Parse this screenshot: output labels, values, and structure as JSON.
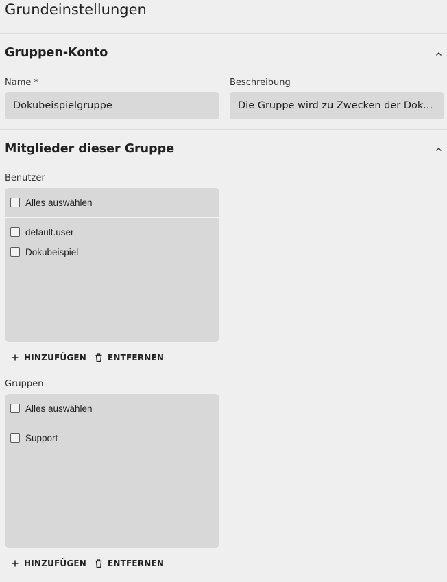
{
  "page": {
    "title": "Grundeinstellungen"
  },
  "group_account": {
    "title": "Gruppen-Konto",
    "name_label": "Name *",
    "name_value": "Dokubeispielgruppe",
    "description_label": "Beschreibung",
    "description_value": "Die Gruppe wird zu Zwecken der Dokumentation angelegt"
  },
  "members": {
    "title": "Mitglieder dieser Gruppe",
    "users": {
      "label": "Benutzer",
      "select_all": "Alles auswählen",
      "items": [
        "default.user",
        "Dokubeispiel"
      ],
      "add_label": "HINZUFÜGEN",
      "remove_label": "ENTFERNEN"
    },
    "groups": {
      "label": "Gruppen",
      "select_all": "Alles auswählen",
      "items": [
        "Support"
      ],
      "add_label": "HINZUFÜGEN",
      "remove_label": "ENTFERNEN"
    }
  },
  "icons": {
    "collapse": "chevron-up-icon",
    "add": "plus-icon",
    "remove": "trash-icon"
  }
}
